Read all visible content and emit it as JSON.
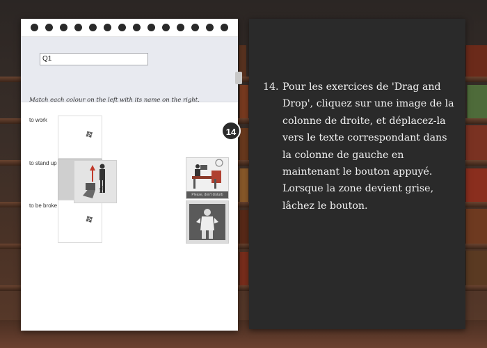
{
  "question": {
    "input_value": "Q1",
    "instruction": "Match each colour on the left with its name on the right.",
    "rows": [
      {
        "label": "to work"
      },
      {
        "label": "to stand up"
      },
      {
        "label": "to be broke"
      }
    ],
    "right_cards": [
      {
        "caption": "Please, don't disturb",
        "icon": "office-desk-illustration"
      },
      {
        "caption": "",
        "icon": "empty-pockets-man-illustration"
      }
    ]
  },
  "callout": {
    "number": "14",
    "step_number": "14.",
    "step_text": "Pour les exercices de 'Drag and Drop', cliquez sur une image de la colonne de droite, et déplacez-la vers le texte correspondant dans la colonne de gauche en maintenant le bouton appuyé. Lorsque la zone devient grise, lâchez le bouton."
  },
  "colors": {
    "panel_bg": "#2a2a2a",
    "notebook_bg": "#ffffff",
    "question_bar_bg": "#e8eaf0",
    "active_dropzone": "#cfcfcf"
  }
}
